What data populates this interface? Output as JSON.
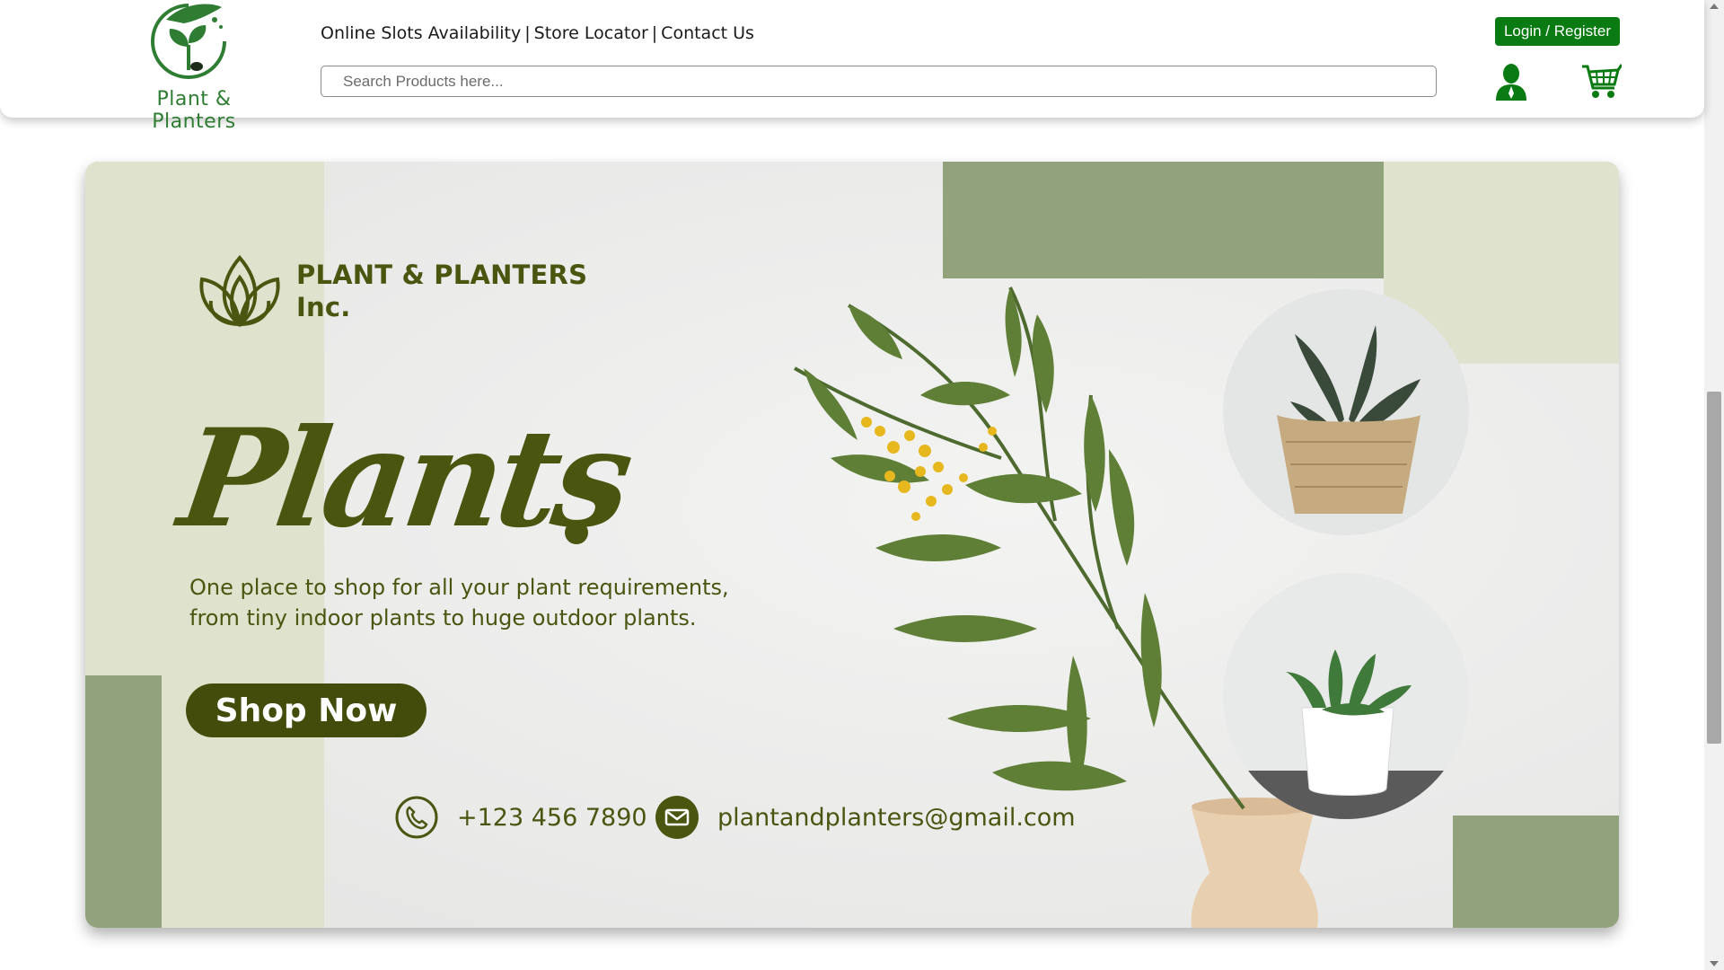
{
  "header": {
    "logo_text": "Plant & Planters",
    "links": [
      "Online Slots Availability",
      "Store Locator",
      "Contact Us"
    ],
    "separator": "|",
    "search_placeholder": "Search Products here...",
    "login_label": "Login / Register",
    "icons": {
      "user": "user-icon",
      "cart": "cart-icon",
      "logo": "plant-seedling-icon"
    }
  },
  "banner": {
    "brand_line1": "PLANT & PLANTERS",
    "brand_line2": "Inc.",
    "hero_word": "Plants",
    "tagline_line1": "One place to shop for all your plant requirements,",
    "tagline_line2": "from tiny indoor plants to huge outdoor plants.",
    "cta_label": "Shop Now",
    "phone": "+123 456 7890",
    "email": "plantandplanters@gmail.com",
    "icons": {
      "brand": "lotus-leaf-icon",
      "phone": "phone-icon",
      "email": "mail-icon"
    }
  },
  "colors": {
    "brand_green": "#0a7a12",
    "olive": "#4a5610",
    "sage": "#91a27c",
    "pale_sage": "#dfe2cc"
  }
}
